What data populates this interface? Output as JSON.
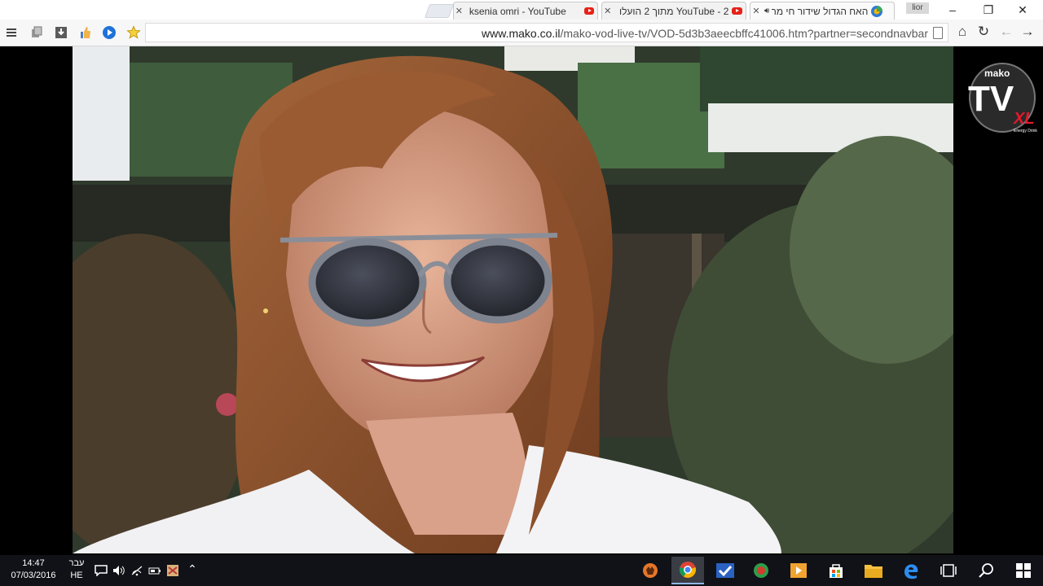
{
  "browser": {
    "tabs": [
      {
        "title": "האח הגדול שידור חי מר",
        "active": true,
        "icon": "mako-tv-icon"
      },
      {
        "title": "YouTube - 2 מתוך 2 הועלו",
        "active": false,
        "icon": "youtube-icon"
      },
      {
        "title": "ksenia omri - YouTube",
        "active": false,
        "icon": "youtube-icon"
      }
    ],
    "profile_label": "lior",
    "window_controls": {
      "minimize": "–",
      "restore": "❐",
      "close": "✕"
    }
  },
  "toolbar": {
    "url_host": "www.mako.co.il",
    "url_path": "/mako-vod-live-tv/VOD-5d3b3aeecbffc41006.htm?partner=secondnavbar",
    "left_icons": [
      "menu-icon",
      "copy-icon",
      "download-icon",
      "thumbs-up-icon",
      "play-circle-icon",
      "star-icon"
    ],
    "right_icons": [
      "home-icon",
      "reload-icon",
      "back-arrow-icon",
      "forward-arrow-icon"
    ]
  },
  "video": {
    "channel_logo": {
      "brand": "mako",
      "tv": "TV",
      "badge": "XL",
      "sub": "Energy Drink"
    }
  },
  "taskbar": {
    "time": "14:47",
    "date": "07/03/2016",
    "language_top": "עבר",
    "language_bottom": "HE",
    "tray_icons": [
      "notification-icon",
      "volume-icon",
      "wifi-icon",
      "battery-icon",
      "app-tray-icon",
      "chevron-up-icon"
    ],
    "pinned_apps": [
      "pawn-app-icon",
      "chrome-icon",
      "check-app-icon",
      "ribbon-app-icon",
      "media-player-icon",
      "store-icon",
      "file-explorer-icon",
      "edge-icon",
      "task-view-icon",
      "search-icon",
      "windows-start-icon"
    ],
    "active_app": "chrome-icon"
  }
}
